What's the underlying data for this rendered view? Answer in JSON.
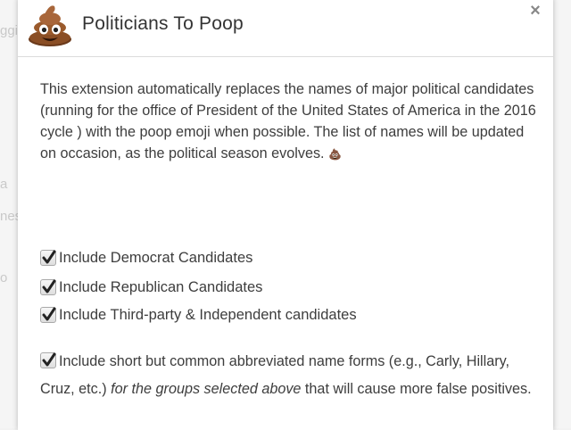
{
  "background_fragments": [
    "ggi",
    "a",
    "nes",
    "o"
  ],
  "dialog": {
    "logo_icon": "poop-emoji-icon",
    "title": "Politicians To Poop",
    "close_glyph": "×"
  },
  "description": {
    "text": "This extension automatically replaces the names of major political candidates (running for the office of President of the United States of America in the 2016 cycle ) with the poop emoji when possible. The list of names will be updated on occasion, as the political season evolves. ",
    "trailing_icon": "💩"
  },
  "options": [
    {
      "label": "Include Democrat Candidates",
      "checked": true
    },
    {
      "label": "Include Republican Candidates",
      "checked": true
    },
    {
      "label": "Include Third-party & Independent candidates",
      "checked": true
    }
  ],
  "abbreviated": {
    "checked": true,
    "text_before": "Include short but common abbreviated name forms (e.g., Carly, Hillary, Cruz, etc.) ",
    "text_italic": "for the groups selected above",
    "text_after": " that will cause more false positives."
  }
}
